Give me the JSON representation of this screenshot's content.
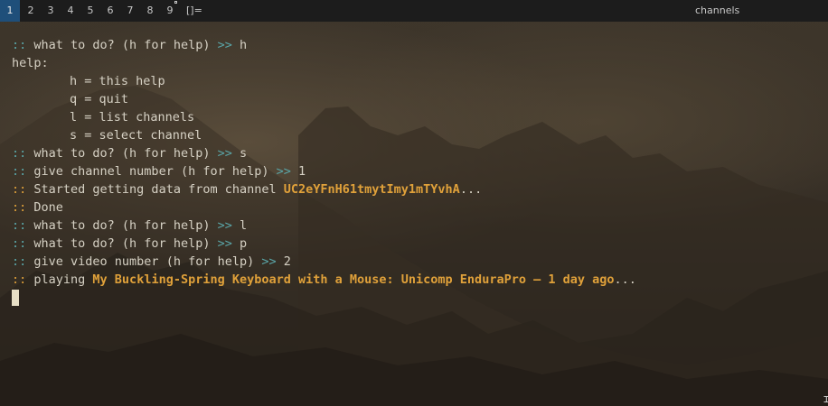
{
  "bar": {
    "workspaces": [
      "1",
      "2",
      "3",
      "4",
      "5",
      "6",
      "7",
      "8",
      "9"
    ],
    "active_workspace": "1",
    "layout_symbol": "[]=",
    "window_title": "channels"
  },
  "terminal": {
    "prompt_marker": "::",
    "prompt_arrow": ">>",
    "lines": {
      "l1_text": " what to do? (h for help) ",
      "l1_input": " h",
      "help_header": "help:",
      "help_h": "h = this help",
      "help_q": "q = quit",
      "help_l": "l = list channels",
      "help_s": "s = select channel",
      "l2_text": " what to do? (h for help) ",
      "l2_input": " s",
      "l3_text": " give channel number (h for help) ",
      "l3_input": " 1",
      "l4_text": " Started getting data from channel ",
      "l4_channel": "UC2eYFnH61tmytImy1mTYvhA",
      "l4_suffix": "...",
      "l5_text": " Done",
      "l6_text": " what to do? (h for help) ",
      "l6_input": " l",
      "l7_text": " what to do? (h for help) ",
      "l7_input": " p",
      "l8_text": " give video number (h for help) ",
      "l8_input": " 2",
      "l9_text": " playing ",
      "l9_video": "My Buckling-Spring Keyboard with a Mouse: Unicomp EnduraPro – 1 day ago",
      "l9_suffix": "..."
    }
  },
  "colors": {
    "bar_bg": "#1c1c1c",
    "active_ws": "#1f4f7a",
    "prompt_cyan": "#5aa6a8",
    "accent_yellow": "#e0a13a",
    "text": "#d6d1c4"
  }
}
